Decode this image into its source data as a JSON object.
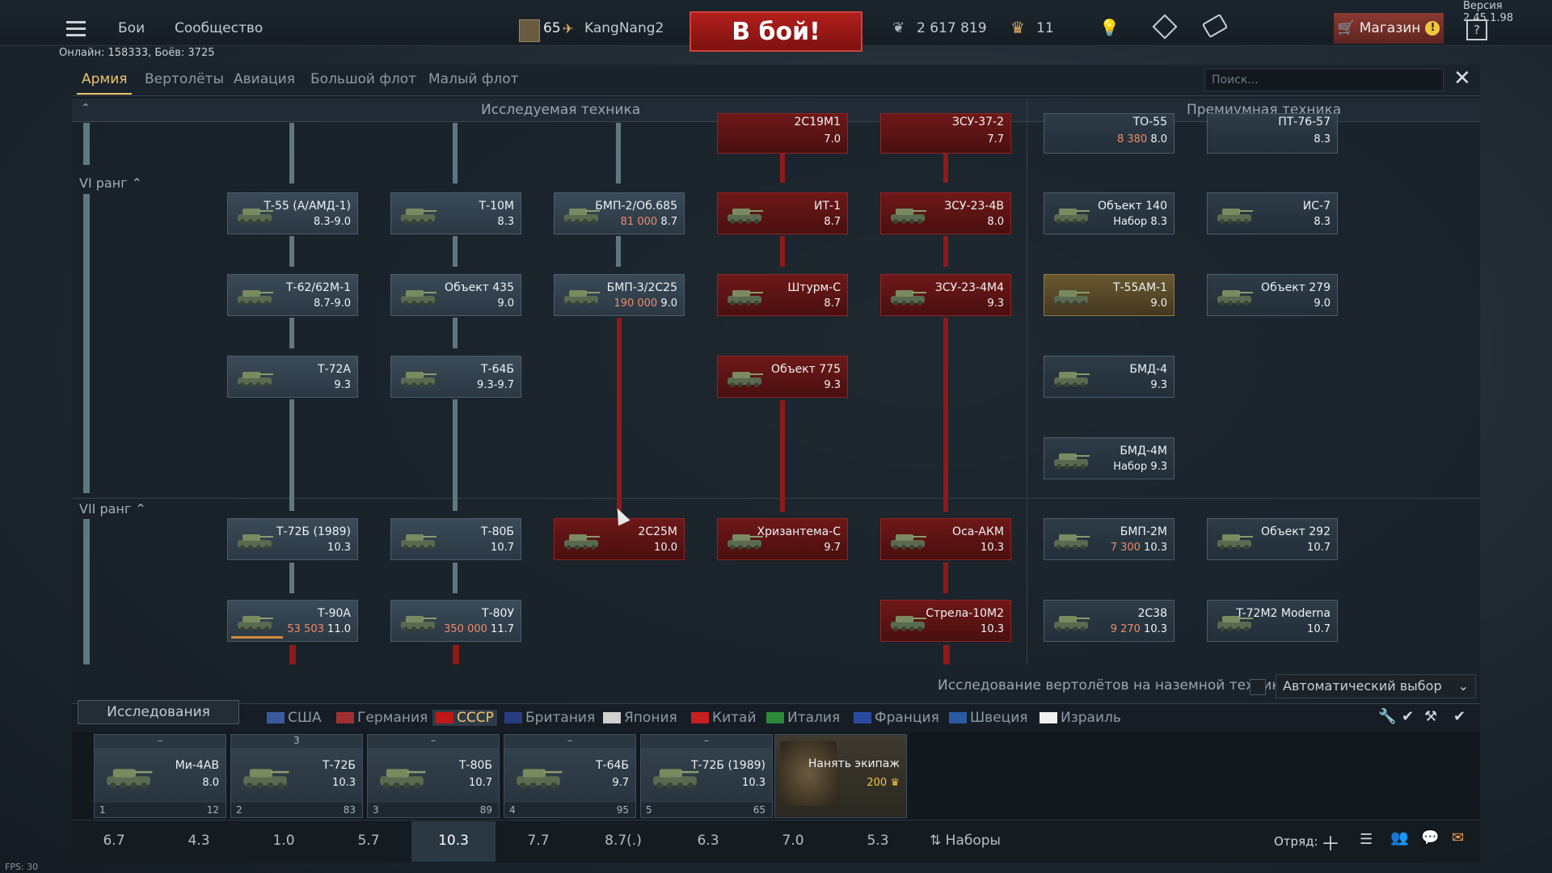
{
  "version": "Версия 2.45.1.98",
  "fps": "FPS: 30",
  "topbar": {
    "battles": "Бои",
    "community": "Сообщество",
    "level": "65",
    "username": "KangNang2",
    "fight": "В бой!",
    "silver": "2 617 819",
    "gold": "11",
    "shop": "Магазин"
  },
  "online": "Онлайн: 158333, Боёв: 3725",
  "tabs": [
    "Армия",
    "Вертолёты",
    "Авиация",
    "Большой флот",
    "Малый флот"
  ],
  "search_placeholder": "Поиск...",
  "columns": {
    "researched": "Исследуемая техника",
    "premium": "Премиумная техника"
  },
  "ranks": {
    "vi": "VI ранг",
    "vii": "VII ранг"
  },
  "vehicles_top_partial": [
    {
      "name": "2С19М1",
      "br": "7.0"
    },
    {
      "name": "ЗСУ-37-2",
      "br": "7.7"
    },
    {
      "name": "ТО-55",
      "cost": "8 380",
      "br": "8.0"
    },
    {
      "name": "ПТ-76-57",
      "br": "8.3"
    }
  ],
  "rank6": [
    {
      "name": "Т-55 (А/АМД-1)",
      "br": "8.3-9.0"
    },
    {
      "name": "Т-10М",
      "br": "8.3"
    },
    {
      "name": "БМП-2/Об.685",
      "cost": "81 000",
      "br": "8.7"
    },
    {
      "name": "ИТ-1",
      "br": "8.7"
    },
    {
      "name": "ЗСУ-23-4В",
      "br": "8.0"
    },
    {
      "name": "Объект 140",
      "sub": "Набор",
      "br": "8.3"
    },
    {
      "name": "ИС-7",
      "br": "8.3"
    },
    {
      "name": "Т-62/62М-1",
      "br": "8.7-9.0"
    },
    {
      "name": "Объект 435",
      "br": "9.0"
    },
    {
      "name": "БМП-3/2С25",
      "cost": "190 000",
      "br": "9.0"
    },
    {
      "name": "Штурм-С",
      "br": "8.7"
    },
    {
      "name": "ЗСУ-23-4М4",
      "br": "9.3"
    },
    {
      "name": "Т-55АМ-1",
      "br": "9.0"
    },
    {
      "name": "Объект 279",
      "br": "9.0"
    },
    {
      "name": "Т-72А",
      "br": "9.3"
    },
    {
      "name": "Т-64Б",
      "br": "9.3-9.7"
    },
    {
      "name": "Объект 775",
      "br": "9.3"
    },
    {
      "name": "БМД-4",
      "br": "9.3"
    },
    {
      "name": "БМД-4М",
      "sub": "Набор",
      "br": "9.3"
    }
  ],
  "rank7": [
    {
      "name": "Т-72Б (1989)",
      "br": "10.3"
    },
    {
      "name": "Т-80Б",
      "br": "10.7"
    },
    {
      "name": "2С25М",
      "br": "10.0"
    },
    {
      "name": "Хризантема-С",
      "br": "9.7"
    },
    {
      "name": "Оса-АКМ",
      "br": "10.3"
    },
    {
      "name": "БМП-2М",
      "cost": "7 300",
      "br": "10.3"
    },
    {
      "name": "Объект 292",
      "br": "10.7"
    },
    {
      "name": "Т-90А",
      "cost": "53 503",
      "br": "11.0"
    },
    {
      "name": "Т-80У",
      "cost": "350 000",
      "br": "11.7"
    },
    {
      "name": "Стрела-10М2",
      "br": "10.3"
    },
    {
      "name": "2С38",
      "cost": "9 270",
      "br": "10.3"
    },
    {
      "name": "T-72M2 Moderna",
      "br": "10.7"
    }
  ],
  "heli_option": "Исследование вертолётов на наземной технике",
  "auto_select": "Автоматический выбор",
  "research_btn": "Исследования",
  "nations": [
    "США",
    "Германия",
    "СССР",
    "Британия",
    "Япония",
    "Китай",
    "Италия",
    "Франция",
    "Швеция",
    "Израиль"
  ],
  "crew": [
    {
      "header": "–",
      "name": "Ми-4АВ",
      "br": "8.0",
      "num": "1",
      "pts": "12"
    },
    {
      "header": "3",
      "name": "Т-72Б",
      "br": "10.3",
      "num": "2",
      "pts": "83"
    },
    {
      "header": "–",
      "name": "Т-80Б",
      "br": "10.7",
      "num": "3",
      "pts": "89"
    },
    {
      "header": "–",
      "name": "Т-64Б",
      "br": "9.7",
      "num": "4",
      "pts": "95"
    },
    {
      "header": "–",
      "name": "Т-72Б (1989)",
      "br": "10.3",
      "num": "5",
      "pts": "65"
    }
  ],
  "hire": {
    "label": "Нанять экипаж",
    "cost": "200"
  },
  "br_list": [
    "6.7",
    "4.3",
    "1.0",
    "5.7",
    "10.3",
    "7.7",
    "8.7(.)",
    "6.3",
    "7.0",
    "5.3"
  ],
  "presets": "Наборы",
  "squad": "Отряд:"
}
